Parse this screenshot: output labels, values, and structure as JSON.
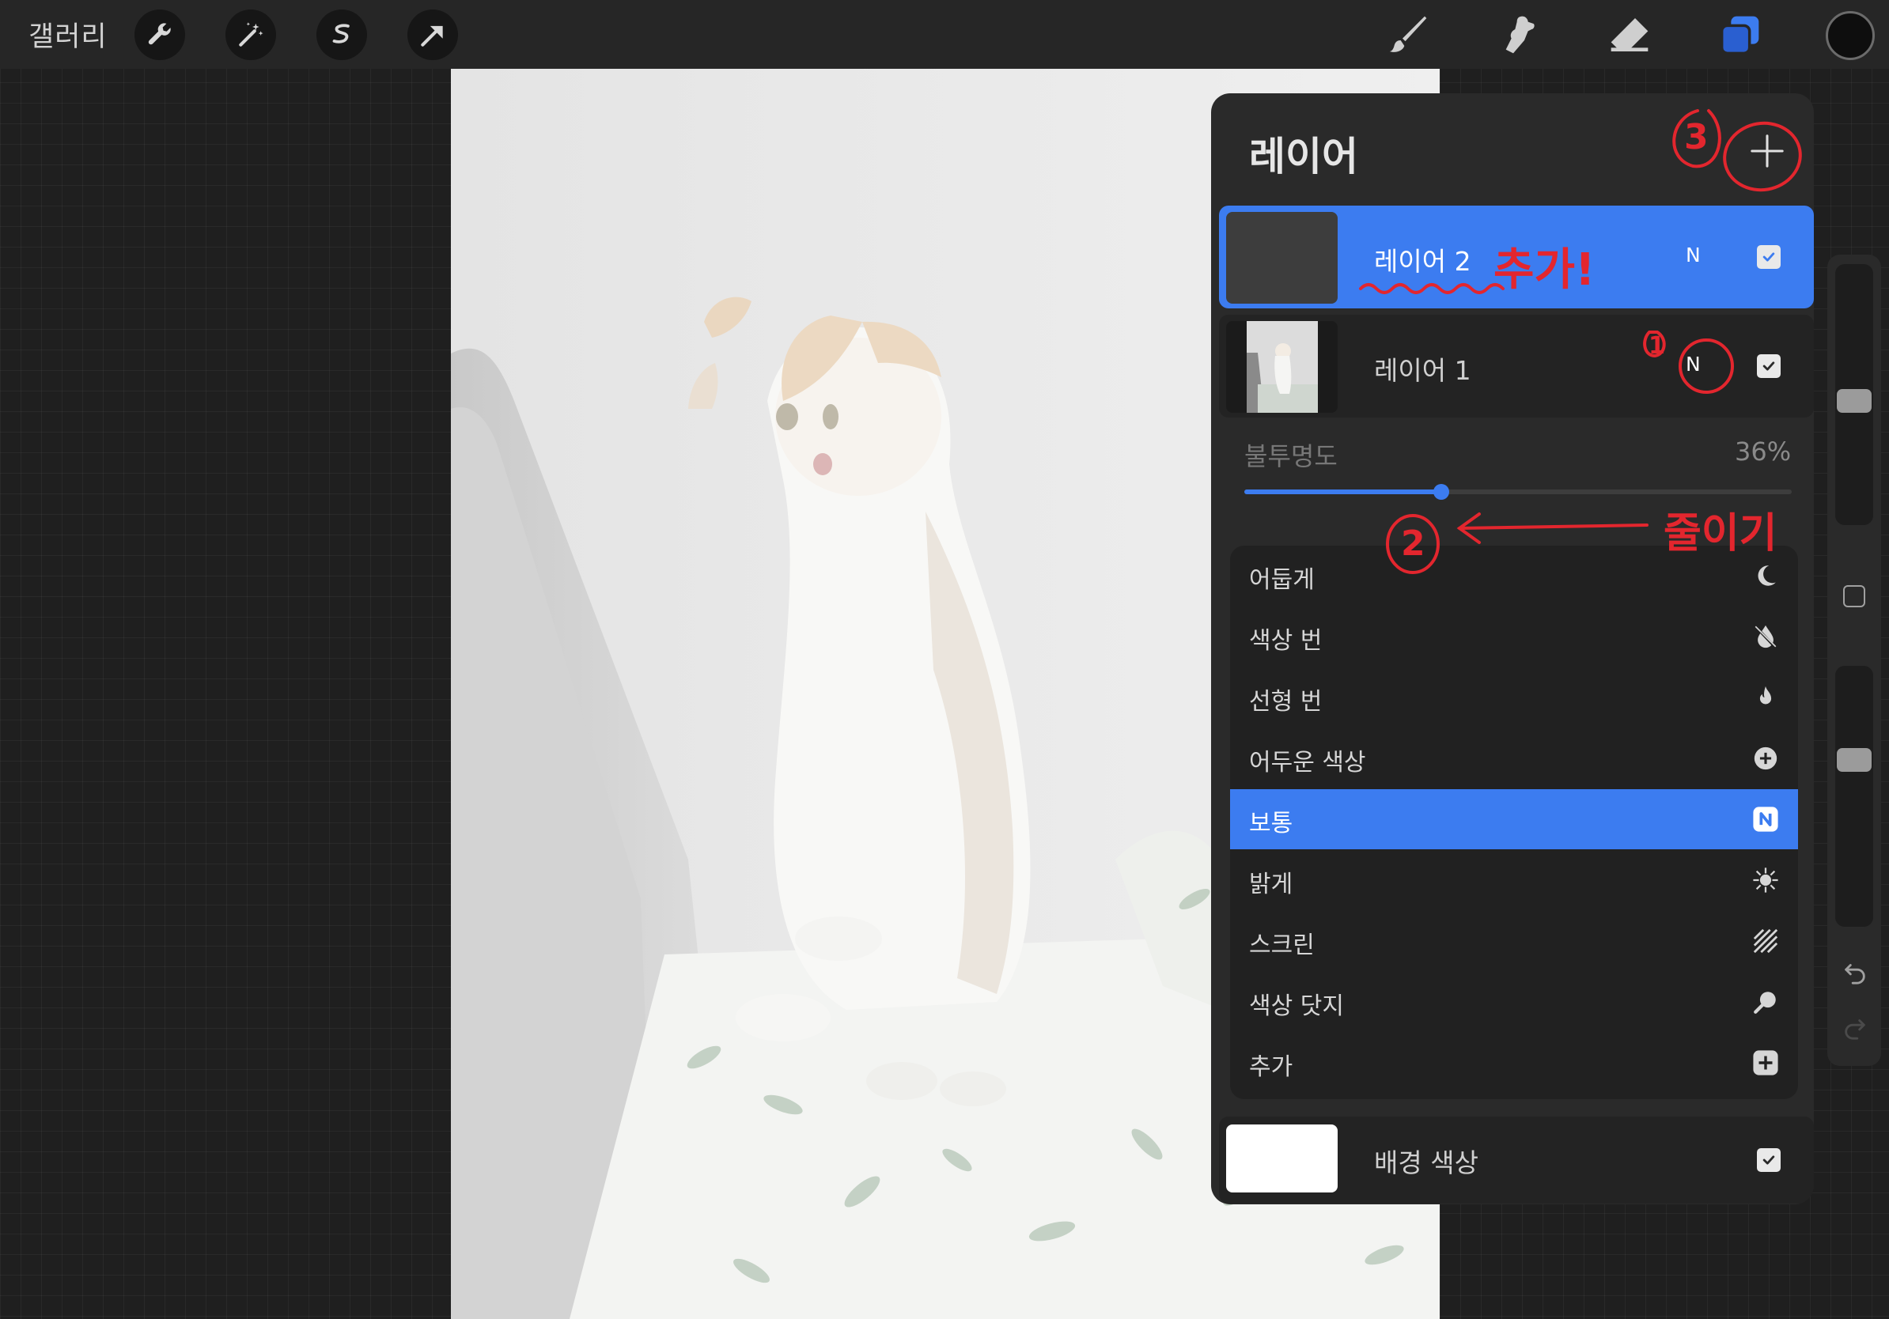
{
  "toolbar": {
    "gallery_label": "갤러리",
    "left_tools": [
      "wrench-icon",
      "magic-wand-icon",
      "selection-icon",
      "transform-arrow-icon"
    ],
    "right_tools": [
      "brush-icon",
      "smudge-icon",
      "eraser-icon",
      "layers-icon"
    ],
    "accent_color": "#3c7cf0"
  },
  "layers_panel": {
    "title": "레이어",
    "layers": [
      {
        "name": "레이어 2",
        "blend": "N",
        "visible": true,
        "active": true
      },
      {
        "name": "레이어 1",
        "blend": "N",
        "visible": true,
        "active": false
      }
    ],
    "opacity": {
      "label": "불투명도",
      "value_text": "36%",
      "value": 36
    },
    "blend_modes": [
      {
        "label": "어둡게",
        "icon": "moon-icon",
        "selected": false
      },
      {
        "label": "색상 번",
        "icon": "burn-drop-icon",
        "selected": false
      },
      {
        "label": "선형 번",
        "icon": "flame-icon",
        "selected": false
      },
      {
        "label": "어두운 색상",
        "icon": "plus-circle-icon",
        "selected": false
      },
      {
        "label": "보통",
        "icon": "n-badge-icon",
        "selected": true
      },
      {
        "label": "밝게",
        "icon": "sun-burst-icon",
        "selected": false
      },
      {
        "label": "스크린",
        "icon": "hatch-icon",
        "selected": false
      },
      {
        "label": "색상 닷지",
        "icon": "dodge-icon",
        "selected": false
      },
      {
        "label": "추가",
        "icon": "plus-square-icon",
        "selected": false
      }
    ],
    "background": {
      "name": "배경 색상",
      "visible": true
    }
  },
  "annotations": {
    "step3": "3",
    "step1": "1",
    "step2": "2",
    "add_note": "추가!",
    "reduce_note": "줄이기"
  }
}
